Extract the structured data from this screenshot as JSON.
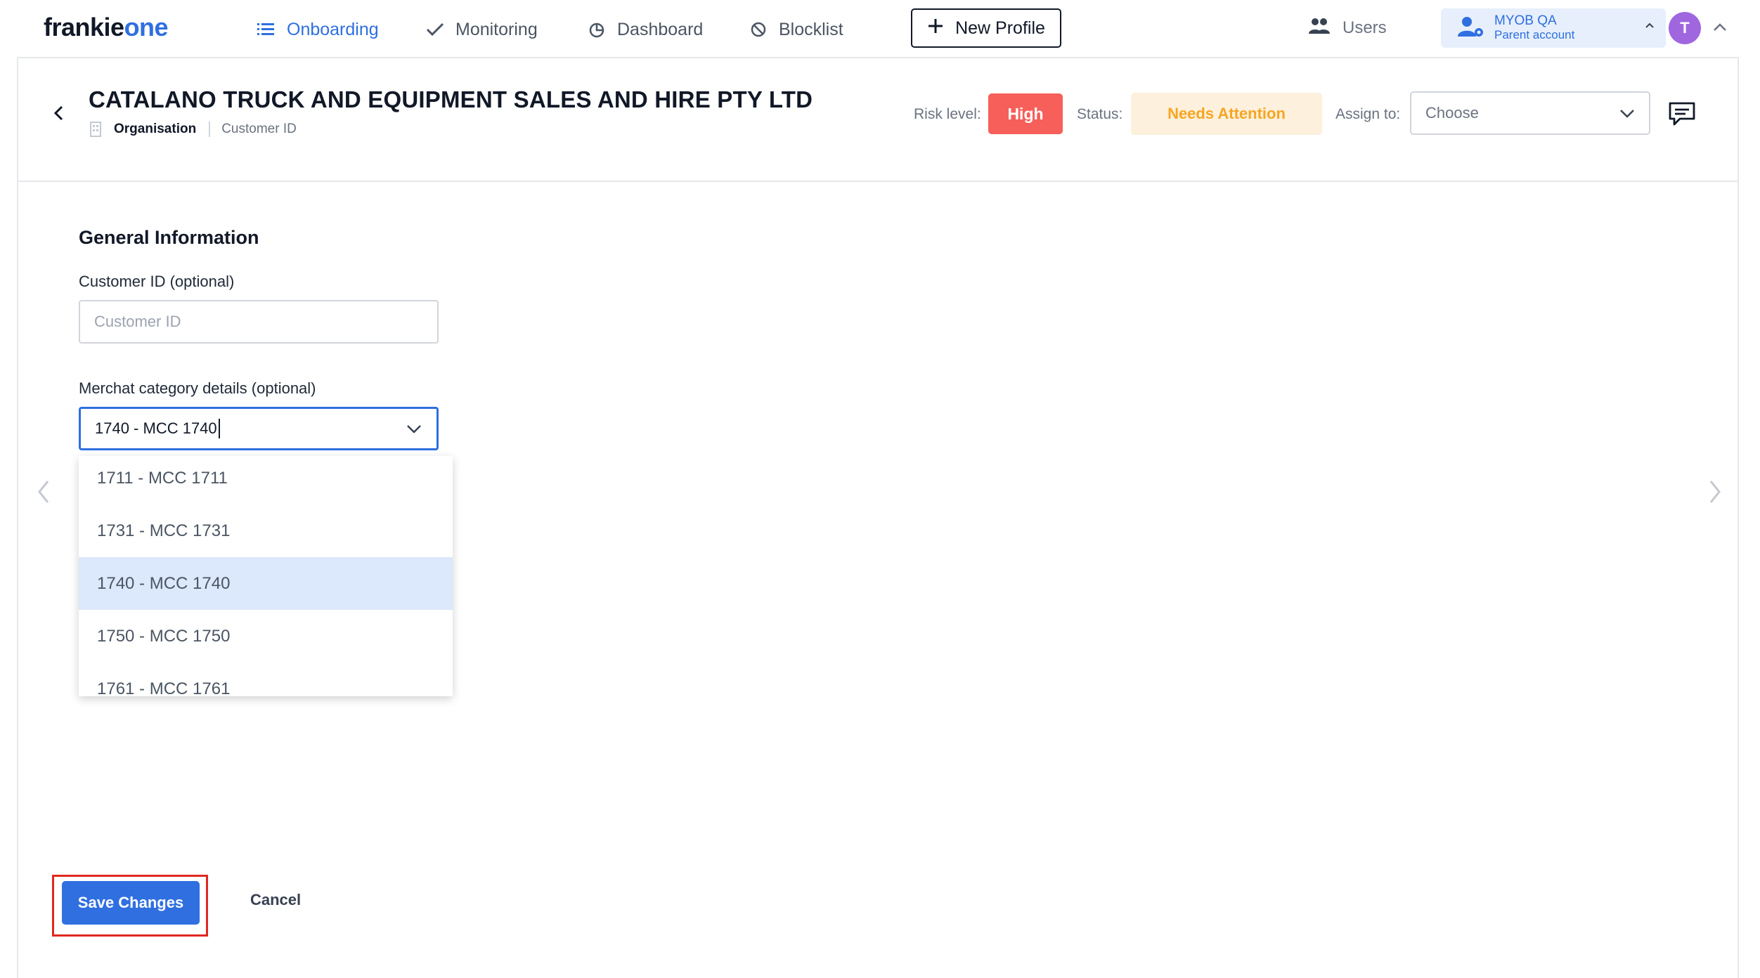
{
  "nav": {
    "logo_main": "frankie",
    "logo_accent": "one",
    "items": [
      {
        "label": "Onboarding",
        "icon": "list-icon",
        "active": true
      },
      {
        "label": "Monitoring",
        "icon": "checkmark-icon",
        "active": false
      },
      {
        "label": "Dashboard",
        "icon": "pie-chart-icon",
        "active": false
      },
      {
        "label": "Blocklist",
        "icon": "block-icon",
        "active": false
      }
    ],
    "new_profile_label": "New Profile",
    "users_label": "Users",
    "account": {
      "name": "MYOB QA",
      "sub": "Parent account"
    },
    "avatar_initial": "T"
  },
  "header": {
    "title": "CATALANO TRUCK AND EQUIPMENT SALES AND HIRE PTY LTD",
    "entity_type": "Organisation",
    "customer_id_label": "Customer ID",
    "risk_label": "Risk level:",
    "risk_value": "High",
    "status_label": "Status:",
    "status_value": "Needs Attention",
    "assign_label": "Assign to:",
    "assign_placeholder": "Choose"
  },
  "form": {
    "section_title": "General Information",
    "customer_id_field_label": "Customer ID (optional)",
    "customer_id_placeholder": "Customer ID",
    "customer_id_value": "",
    "mcc_field_label": "Merchat category details (optional)",
    "mcc_value": "1740 - MCC 1740",
    "mcc_options": [
      "1711 - MCC 1711",
      "1731 - MCC 1731",
      "1740 - MCC 1740",
      "1750 - MCC 1750",
      "1761 - MCC 1761"
    ],
    "mcc_selected_index": 2
  },
  "actions": {
    "save_label": "Save Changes",
    "cancel_label": "Cancel"
  },
  "colors": {
    "accent": "#2f6fe0",
    "risk_high": "#f65f5a",
    "status_attention_bg": "#fdf0dc",
    "status_attention_text": "#f5a623",
    "highlight_box": "#e0281f"
  }
}
